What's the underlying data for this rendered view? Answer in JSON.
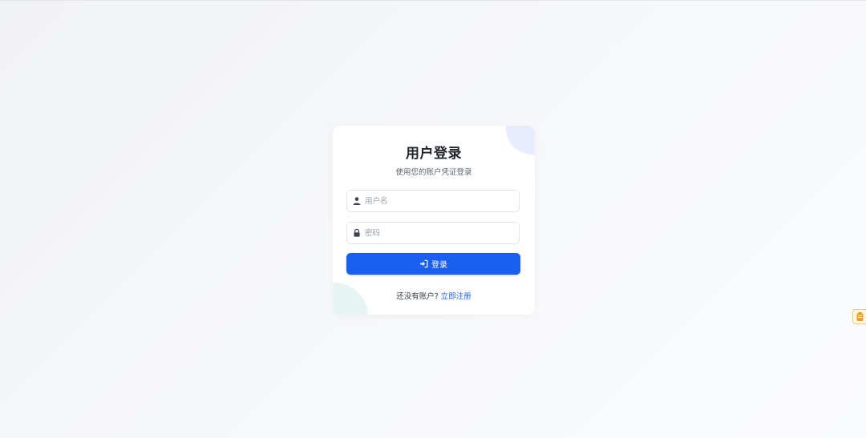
{
  "login": {
    "title": "用户登录",
    "subtitle": "使用您的账户凭证登录",
    "username_placeholder": "用户名",
    "password_placeholder": "密码",
    "submit_label": "登录",
    "no_account_text": "还没有账户?",
    "register_link": "立即注册"
  },
  "icons": {
    "username": "user-icon",
    "password": "lock-icon",
    "submit": "sign-in-icon",
    "side_widget": "battery-icon"
  },
  "colors": {
    "primary": "#1a5ff0",
    "widget_accent": "#f0a020"
  }
}
